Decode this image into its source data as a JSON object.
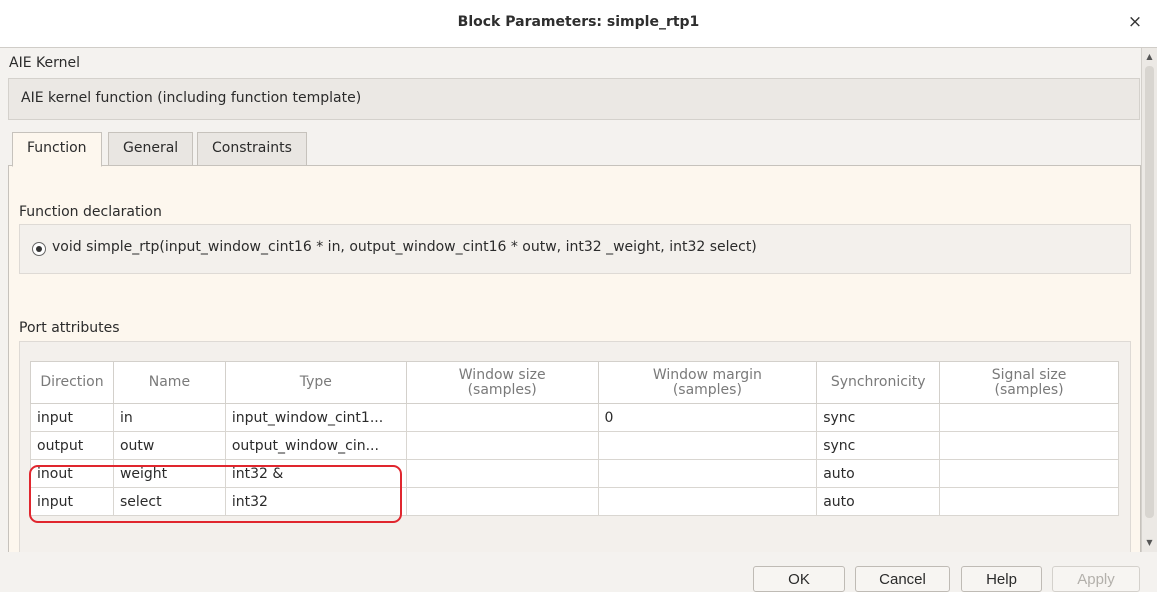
{
  "window": {
    "title": "Block Parameters: simple_rtp1",
    "close_symbol": "×"
  },
  "block": {
    "section_title": "AIE Kernel",
    "description": "AIE kernel function (including function template)"
  },
  "tabs": [
    {
      "label": "Function",
      "active": true
    },
    {
      "label": "General",
      "active": false
    },
    {
      "label": "Constraints",
      "active": false
    }
  ],
  "function_tab": {
    "declaration_label": "Function declaration",
    "declaration": "void simple_rtp(input_window_cint16 * in, output_window_cint16 * outw, int32 _weight, int32 select)",
    "declaration_selected": true,
    "port_attributes_label": "Port attributes"
  },
  "ports_table": {
    "headers": [
      "Direction",
      "Name",
      "Type",
      "Window size\n(samples)",
      "Window margin\n(samples)",
      "Synchronicity",
      "Signal size\n(samples)"
    ],
    "header_lines": [
      [
        "Direction"
      ],
      [
        "Name"
      ],
      [
        "Type"
      ],
      [
        "Window size",
        "(samples)"
      ],
      [
        "Window margin",
        "(samples)"
      ],
      [
        "Synchronicity"
      ],
      [
        "Signal size",
        "(samples)"
      ]
    ],
    "rows": [
      [
        "input",
        "in",
        "input_window_cint1...",
        "",
        "0",
        "sync",
        ""
      ],
      [
        "output",
        "outw",
        "output_window_cin...",
        "",
        "",
        "sync",
        ""
      ],
      [
        "inout",
        "weight",
        "int32 &",
        "",
        "",
        "auto",
        ""
      ],
      [
        "input",
        "select",
        "int32",
        "",
        "",
        "auto",
        ""
      ]
    ],
    "highlighted_rows": [
      2,
      3
    ],
    "highlight_color": "#e0262e"
  },
  "buttons": {
    "ok": "OK",
    "cancel": "Cancel",
    "help": "Help",
    "apply": "Apply",
    "apply_disabled": true
  },
  "icons": {
    "close": "close-icon",
    "scroll_up": "scroll-up-arrow-icon",
    "scroll_down": "scroll-down-arrow-icon"
  }
}
